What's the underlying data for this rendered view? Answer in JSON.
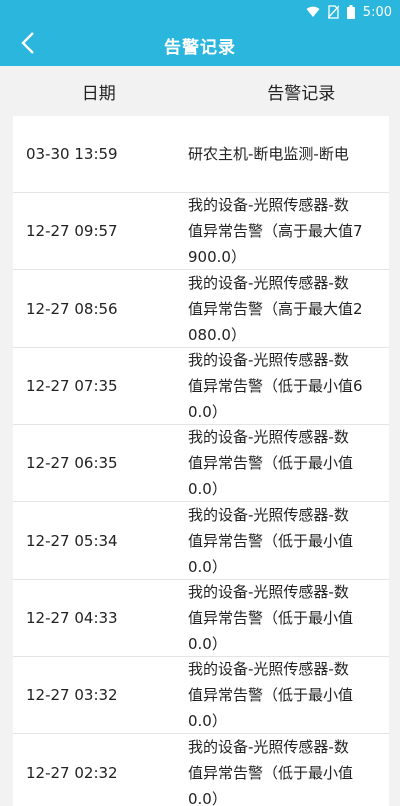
{
  "status_bar": {
    "time": "5:00"
  },
  "app_bar": {
    "title": "告警记录"
  },
  "table_header": {
    "date_label": "日期",
    "record_label": "告警记录"
  },
  "rows": [
    {
      "date": "03-30 13:59",
      "message": "研农主机-断电监测-断电"
    },
    {
      "date": "12-27 09:57",
      "message": "我的设备-光照传感器-数值异常告警（高于最大值7900.0）"
    },
    {
      "date": "12-27 08:56",
      "message": "我的设备-光照传感器-数值异常告警（高于最大值2080.0）"
    },
    {
      "date": "12-27 07:35",
      "message": "我的设备-光照传感器-数值异常告警（低于最小值60.0）"
    },
    {
      "date": "12-27 06:35",
      "message": "我的设备-光照传感器-数值异常告警（低于最小值0.0）"
    },
    {
      "date": "12-27 05:34",
      "message": "我的设备-光照传感器-数值异常告警（低于最小值0.0）"
    },
    {
      "date": "12-27 04:33",
      "message": "我的设备-光照传感器-数值异常告警（低于最小值0.0）"
    },
    {
      "date": "12-27 03:32",
      "message": "我的设备-光照传感器-数值异常告警（低于最小值0.0）"
    },
    {
      "date": "12-27 02:32",
      "message": "我的设备-光照传感器-数值异常告警（低于最小值0.0）"
    }
  ]
}
